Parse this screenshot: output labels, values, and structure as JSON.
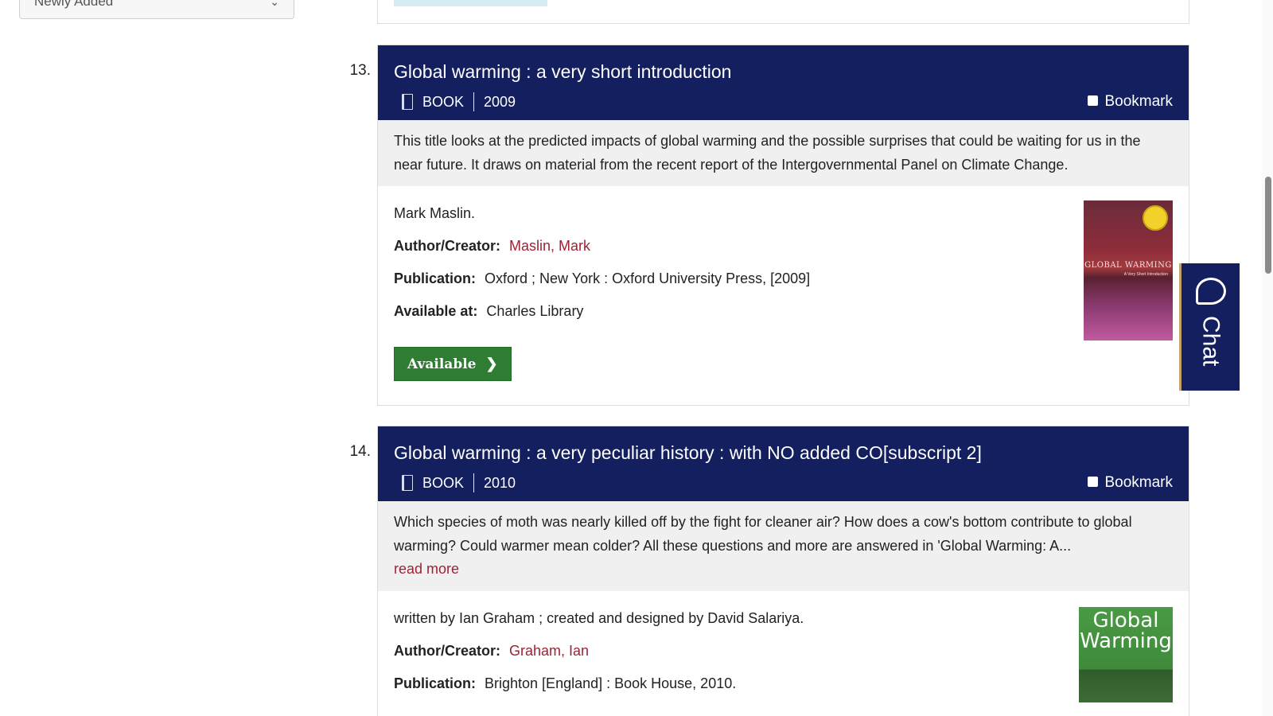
{
  "sidebar": {
    "sort_value": "Newly Added",
    "chevron_icon": "chevron-down-icon"
  },
  "chat": {
    "label": "Chat",
    "icon": "chat-bubble-icon"
  },
  "results": [
    {
      "number": "13.",
      "title": "Global warming : a very short introduction",
      "type": "BOOK",
      "year": "2009",
      "bookmark_label": "Bookmark",
      "abstract": "This title looks at the predicted impacts of global warming and the possible surprises that could be waiting for us in the near future. It draws on material from the recent report of the Intergovernmental Panel on Climate Change.",
      "statement": "Mark Maslin.",
      "author_label": "Author/Creator:",
      "author": "Maslin, Mark",
      "publication_label": "Publication:",
      "publication": "Oxford ; New York : Oxford University Press, [2009]",
      "available_label": "Available at:",
      "available_at": "Charles Library",
      "status_button": "Available",
      "cover_text": "GLOBAL WARMING",
      "cover_subtext": "A Very Short Introduction"
    },
    {
      "number": "14.",
      "title": "Global warming : a very peculiar history : with NO added CO[subscript 2]",
      "type": "BOOK",
      "year": "2010",
      "bookmark_label": "Bookmark",
      "abstract": "Which species of moth was nearly killed off by the fight for cleaner air? How does a cow's bottom contribute to global warming? Could warmer mean colder? All these questions and more are answered in 'Global Warming: A...",
      "read_more": "read more",
      "statement": "written by Ian Graham ; created and designed by David Salariya.",
      "author_label": "Author/Creator:",
      "author": "Graham, Ian",
      "publication_label": "Publication:",
      "publication": "Brighton [England] : Book House, 2010.",
      "cover_text_line1": "Global",
      "cover_text_line2": "Warming"
    }
  ],
  "colors": {
    "header_navy": "#131f5e",
    "link_red": "#9d2235",
    "available_green": "#2f7d32",
    "abstract_bg": "#f0f0f0"
  }
}
